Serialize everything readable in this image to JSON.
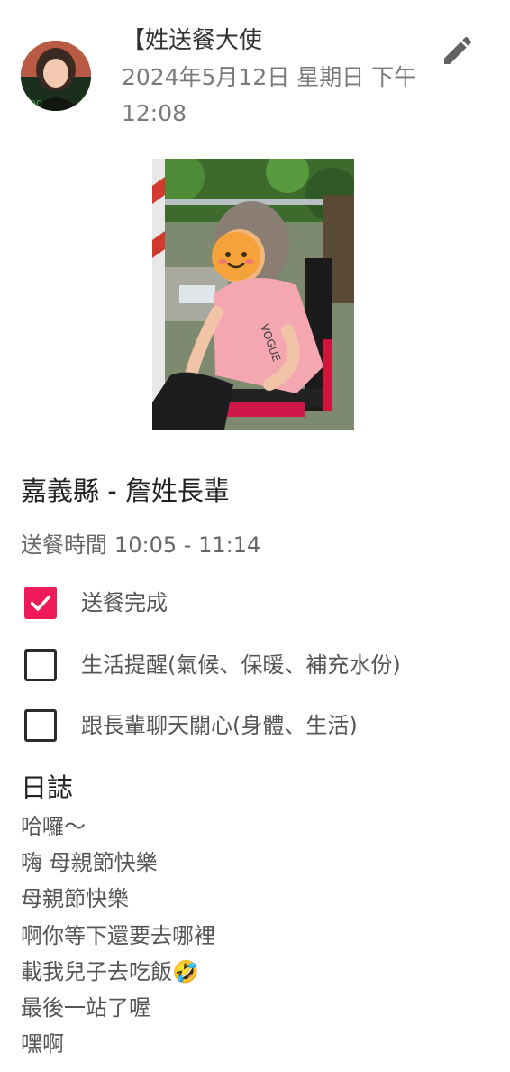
{
  "post": {
    "author": "【姓送餐大使",
    "timestamp": "2024年5月12日 星期日 下午12:08"
  },
  "header": {
    "edit_icon": "pencil-icon"
  },
  "meal": {
    "title": "嘉義縣 - 詹姓長輩",
    "time_label": "送餐時間",
    "time_value": "10:05 - 11:14"
  },
  "checklist": [
    {
      "label": "送餐完成",
      "checked": true
    },
    {
      "label": "生活提醒(氣候、保暖、補充水份)",
      "checked": false
    },
    {
      "label": "跟長輩聊天關心(身體、生活)",
      "checked": false
    }
  ],
  "log": {
    "heading": "日誌",
    "lines": [
      "哈囉～",
      "嗨 母親節快樂",
      "母親節快樂",
      "啊你等下還要去哪裡",
      "載我兒子去吃飯🤣",
      "最後一站了喔",
      "嘿啊"
    ]
  },
  "colors": {
    "accent_checkbox": "#ef1a5a",
    "muted_text": "#7a7a7a",
    "icon": "#616161"
  }
}
